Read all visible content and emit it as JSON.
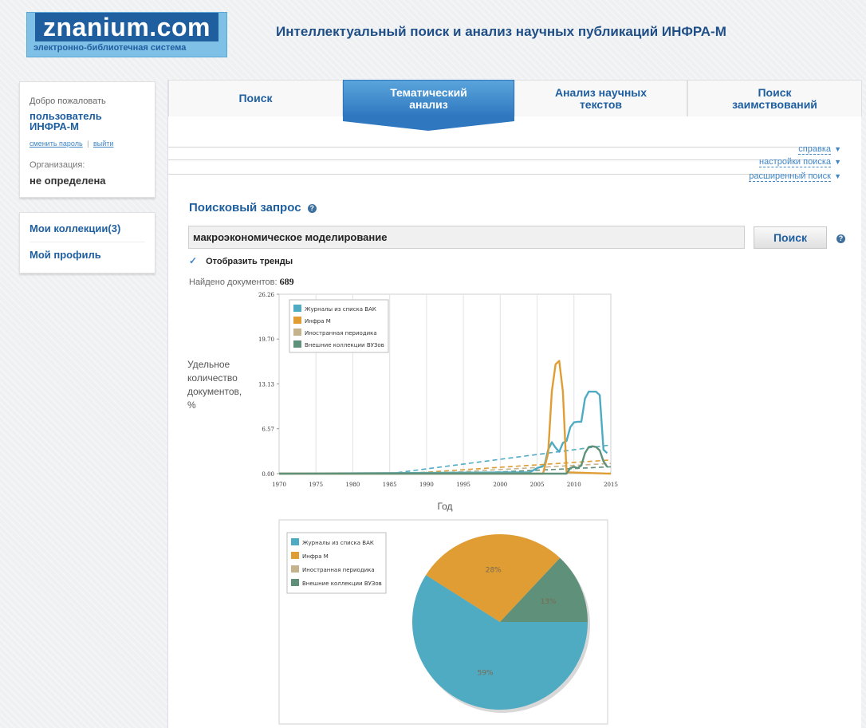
{
  "logo": {
    "name": "znanium.com",
    "subtitle": "электронно-библиотечная система"
  },
  "site_title": "Интеллектуальный поиск и анализ научных публикаций ИНФРА-М",
  "user": {
    "welcome": "Добро пожаловать",
    "name_line1": "пользователь",
    "name_line2": "ИНФРА-М",
    "change_password": "сменить пароль",
    "separator": "|",
    "logout": "выйти",
    "org_label": "Организация:",
    "org_value": "не определена"
  },
  "nav": {
    "collections": "Мои коллекции(3)",
    "profile": "Мой профиль"
  },
  "tabs": [
    {
      "line1": "Поиск",
      "line2": ""
    },
    {
      "line1": "Тематический",
      "line2": "анализ"
    },
    {
      "line1": "Анализ научных",
      "line2": "текстов"
    },
    {
      "line1": "Поиск",
      "line2": "заимствований"
    }
  ],
  "utility": {
    "help": "справка",
    "settings": "настройки поиска",
    "advanced": "расширенный поиск"
  },
  "search": {
    "section_title": "Поисковый запрос",
    "query": "макроэкономическое моделирование",
    "button": "Поиск",
    "show_trends": "Отобразить тренды",
    "found_label": "Найдено документов:",
    "found_count": "689"
  },
  "colors": {
    "vak": "#4fabc2",
    "infra": "#e09d34",
    "foreign": "#c4b38c",
    "vuz": "#5f907a"
  },
  "chart_data": [
    {
      "type": "line",
      "ylabel": "Удельное количество документов, %",
      "xlabel": "Год",
      "xlim": [
        1970,
        2015
      ],
      "ylim": [
        0,
        26.26
      ],
      "yticks": [
        "0.00",
        "6.57",
        "13.13",
        "19.70",
        "26.26"
      ],
      "xticks": [
        "1970",
        "1975",
        "1980",
        "1985",
        "1990",
        "1995",
        "2000",
        "2005",
        "2010",
        "2015"
      ],
      "legend": [
        "Журналы из списка ВАК",
        "Инфра М",
        "Иностранная периодика",
        "Внешние коллекции ВУЗов"
      ],
      "legend_position": "top-left",
      "grid": true,
      "series": [
        {
          "name": "Журналы из списка ВАК",
          "color": "#4fabc2",
          "x": [
            1970,
            2004,
            2005,
            2006,
            2006.5,
            2007,
            2007.5,
            2008,
            2008.5,
            2009,
            2009.5,
            2010,
            2010.5,
            2011,
            2011.5,
            2012,
            2013,
            2013.5,
            2014,
            2014.5
          ],
          "y": [
            0,
            0.2,
            0.8,
            1.2,
            3.5,
            4.6,
            3.8,
            3.2,
            4.5,
            4.8,
            6.8,
            7.5,
            7.6,
            7.6,
            11.0,
            12.0,
            12.0,
            11.5,
            3.5,
            3.0
          ]
        },
        {
          "name": "Инфра М",
          "color": "#e09d34",
          "x": [
            1970,
            2005.8,
            2006.5,
            2007,
            2007.5,
            2008,
            2008.5,
            2009,
            2015
          ],
          "y": [
            0,
            0,
            3.0,
            12.0,
            16.0,
            16.5,
            12.0,
            0.2,
            0
          ]
        },
        {
          "name": "Внешние коллекции ВУЗов",
          "color": "#5f907a",
          "x": [
            1970,
            2009,
            2009.5,
            2010,
            2010.5,
            2011,
            2011.5,
            2012,
            2012.5,
            2013,
            2013.5,
            2014,
            2014.5
          ],
          "y": [
            0,
            0,
            0.8,
            1.0,
            0.8,
            1.2,
            3.0,
            3.9,
            4.0,
            3.9,
            3.4,
            1.8,
            1.0
          ]
        }
      ],
      "trend_lines": [
        {
          "series": "Журналы из списка ВАК",
          "x": [
            1985,
            2015
          ],
          "y": [
            0,
            4.2
          ]
        },
        {
          "series": "Инфра М",
          "x": [
            1987,
            2015
          ],
          "y": [
            0,
            2.0
          ]
        },
        {
          "series": "Иностранная периодика",
          "x": [
            1990,
            2015
          ],
          "y": [
            0,
            1.5
          ]
        },
        {
          "series": "Внешние коллекции ВУЗов",
          "x": [
            1995,
            2015
          ],
          "y": [
            0,
            1.0
          ]
        }
      ]
    },
    {
      "type": "pie",
      "legend": [
        "Журналы из списка ВАК",
        "Инфра М",
        "Иностранная периодика",
        "Внешние коллекции ВУЗов"
      ],
      "legend_position": "top-left",
      "slices": [
        {
          "name": "Журналы из списка ВАК",
          "value": 59,
          "label": "59%",
          "color": "#4fabc2"
        },
        {
          "name": "Инфра М",
          "value": 28,
          "label": "28%",
          "color": "#e09d34"
        },
        {
          "name": "Внешние коллекции ВУЗов",
          "value": 13,
          "label": "13%",
          "color": "#5f907a"
        }
      ]
    }
  ]
}
